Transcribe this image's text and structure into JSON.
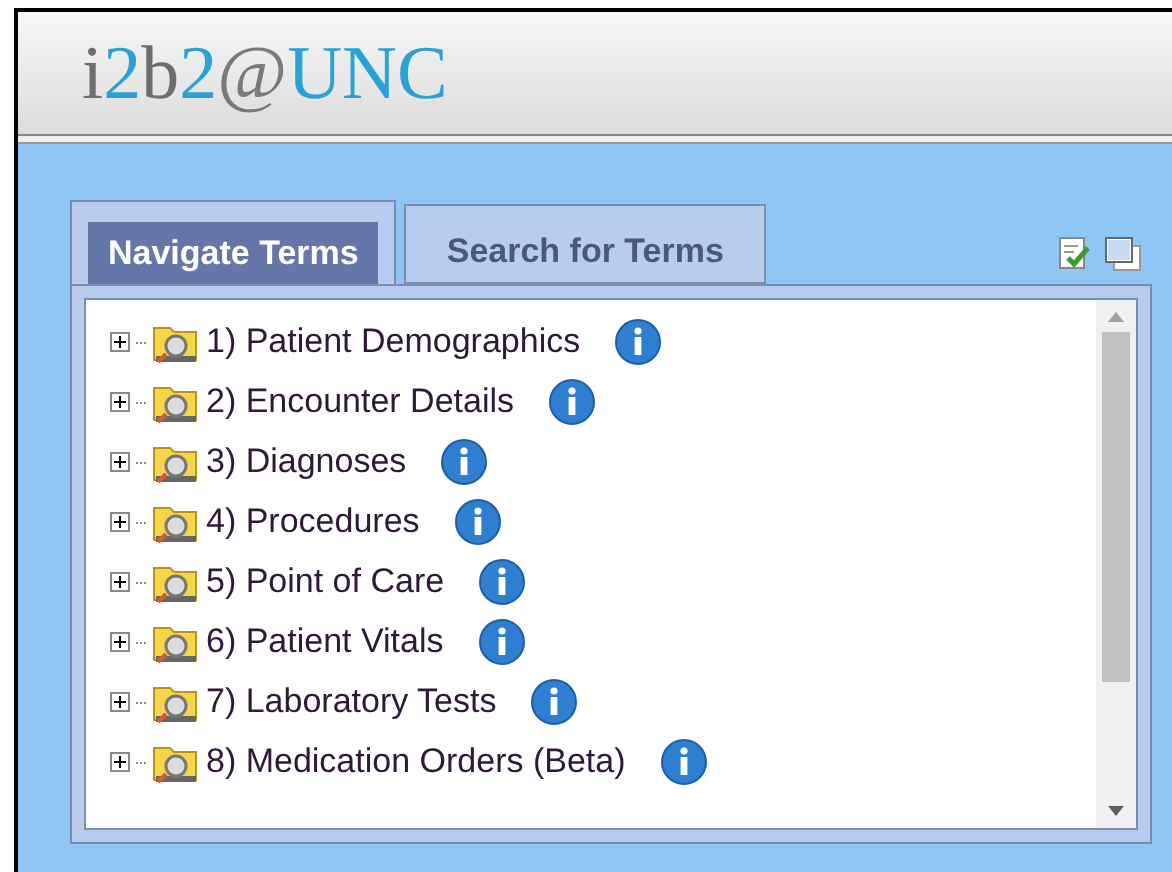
{
  "logo": [
    {
      "text": "i",
      "color": "#6d6d6d"
    },
    {
      "text": "2",
      "color": "#29a3d6"
    },
    {
      "text": "b",
      "color": "#6d6d6d"
    },
    {
      "text": "2",
      "color": "#29a3d6"
    },
    {
      "text": "@",
      "color": "#7a7a7a"
    },
    {
      "text": "UNC",
      "color": "#29a3d6"
    }
  ],
  "tabs": [
    {
      "label": "Navigate Terms",
      "selected": true
    },
    {
      "label": "Search for Terms",
      "selected": false
    }
  ],
  "tree": [
    {
      "label": "1) Patient Demographics",
      "expanded": false
    },
    {
      "label": "2) Encounter Details",
      "expanded": false
    },
    {
      "label": "3) Diagnoses",
      "expanded": false
    },
    {
      "label": "4) Procedures",
      "expanded": false
    },
    {
      "label": "5) Point of Care",
      "expanded": false
    },
    {
      "label": "6) Patient Vitals",
      "expanded": false
    },
    {
      "label": "7) Laboratory Tests",
      "expanded": false
    },
    {
      "label": "8) Medication Orders (Beta)",
      "expanded": false
    }
  ]
}
